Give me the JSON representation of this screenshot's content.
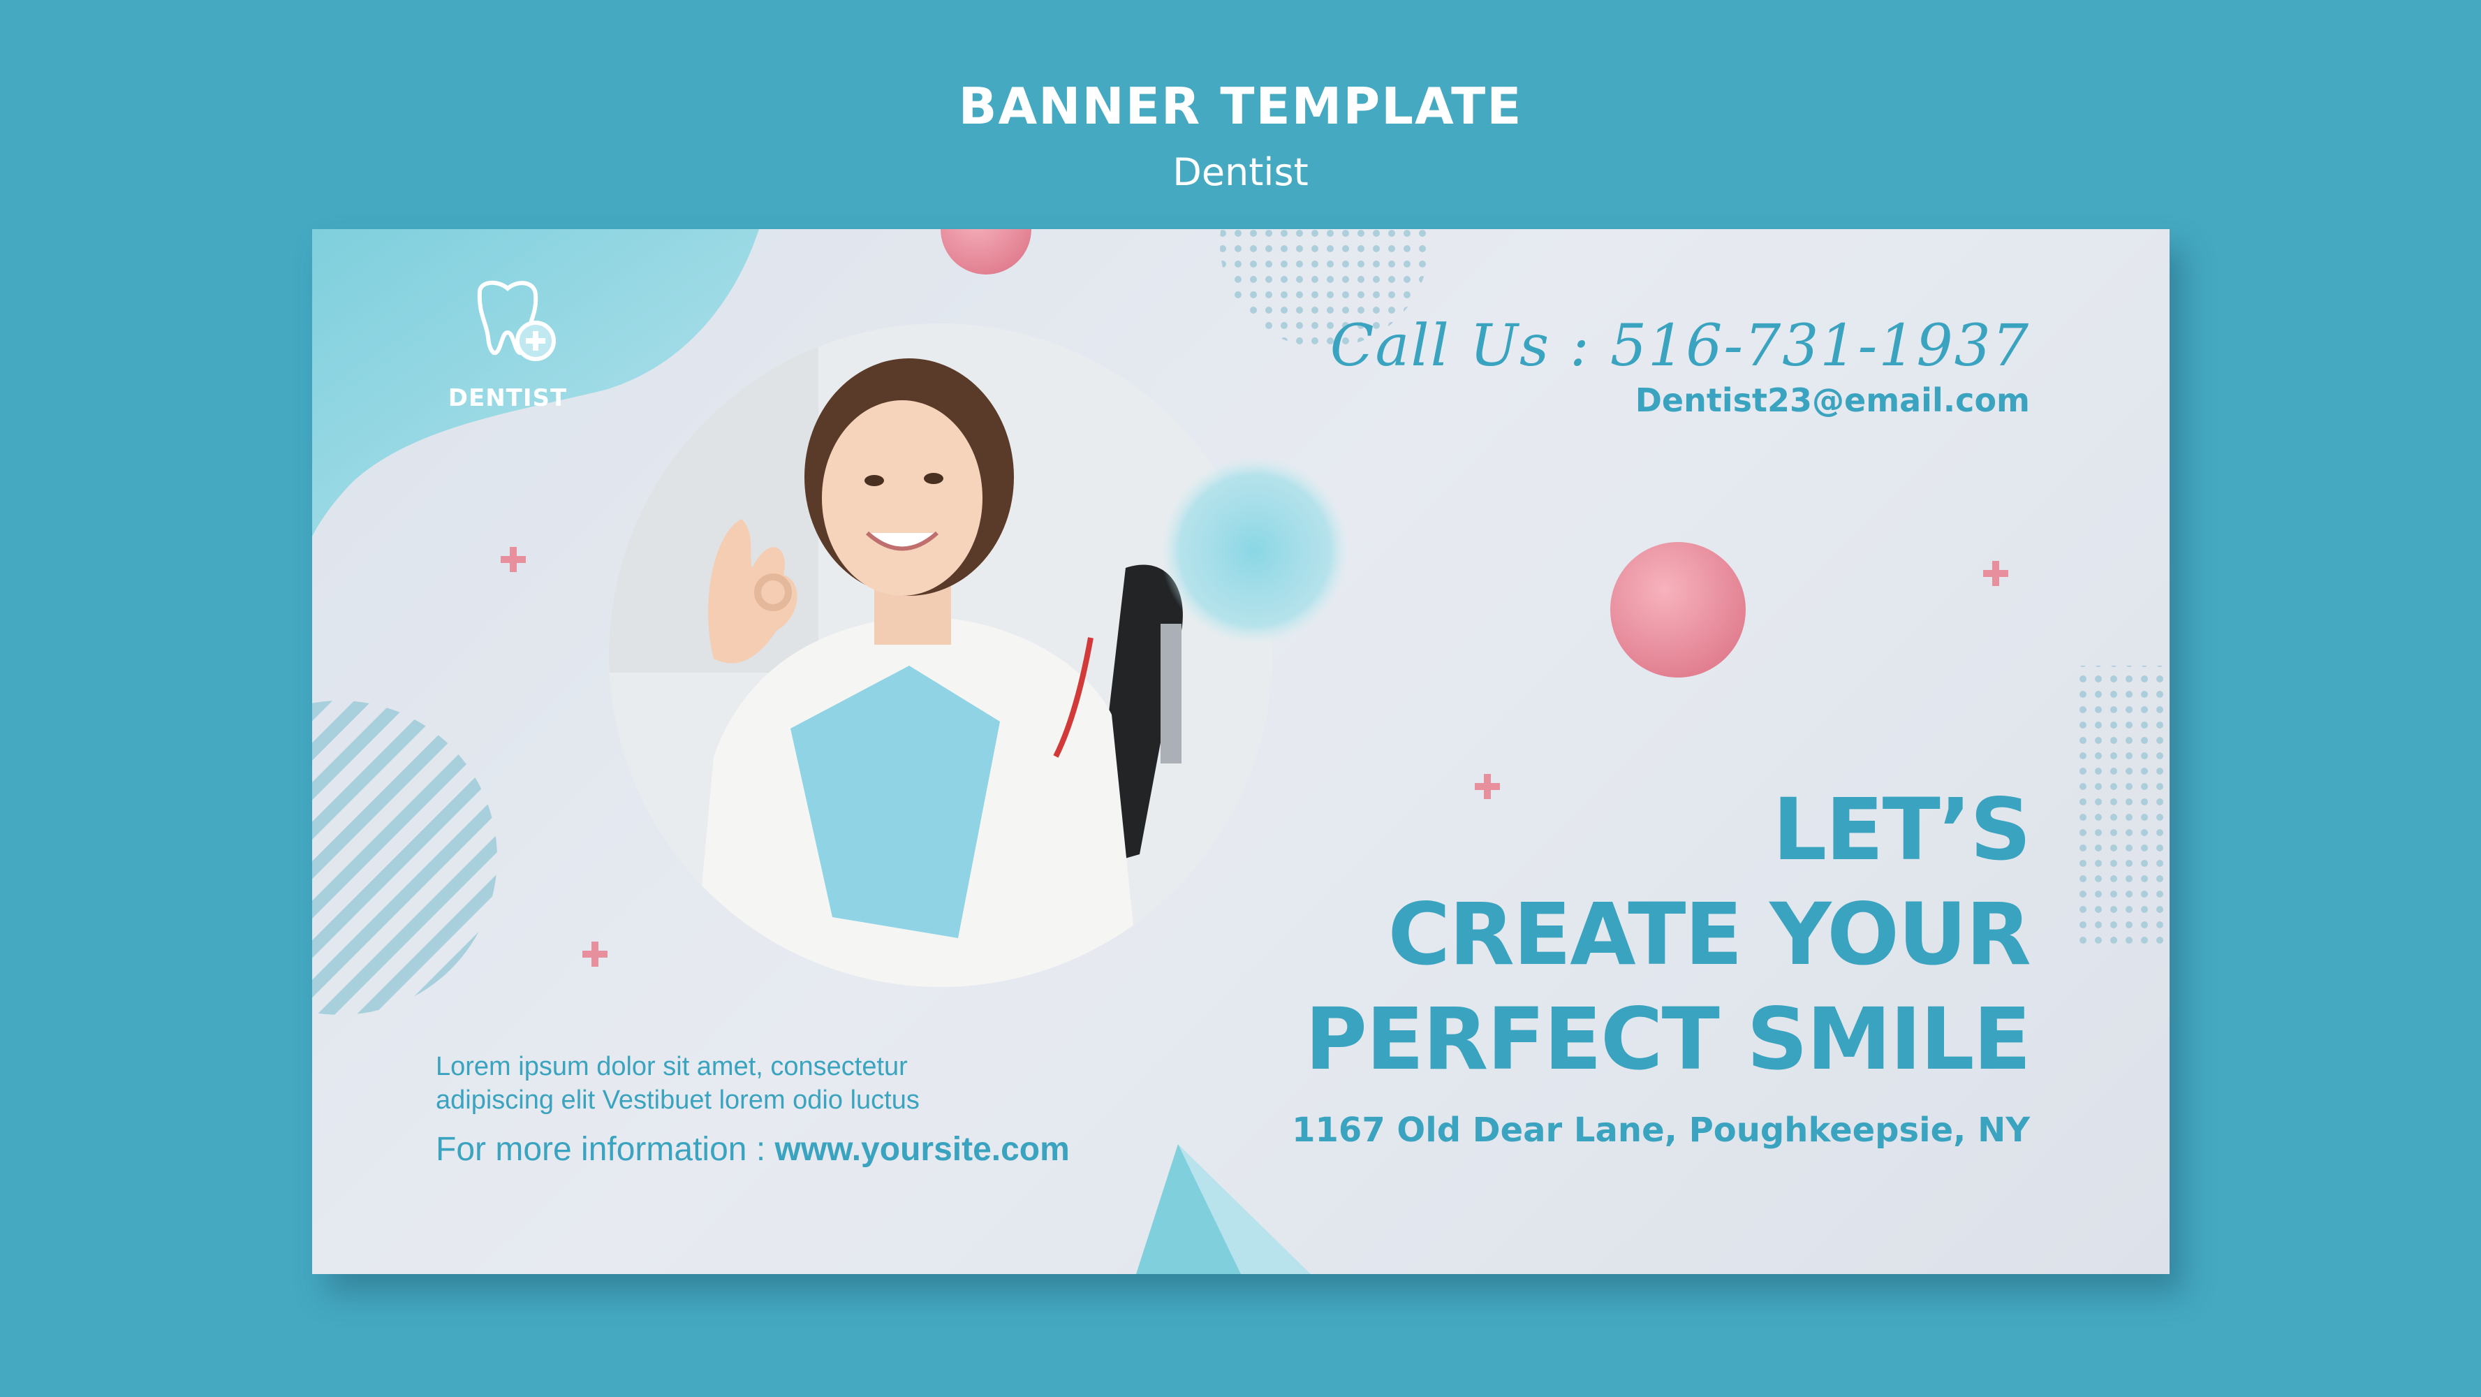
{
  "header": {
    "title": "BANNER TEMPLATE",
    "subtitle": "Dentist"
  },
  "banner": {
    "logo_text": "DENTIST",
    "call_text": "Call Us : 516-731-1937",
    "email": "Dentist23@email.com",
    "headline": [
      "LET’S",
      "CREATE YOUR",
      "PERFECT SMILE"
    ],
    "address": "1167  Old Dear Lane, Poughkeepsie, NY",
    "lorem_lines": [
      "Lorem ipsum dolor sit amet, consectetur",
      "adipiscing elit Vestibuet lorem odio luctus"
    ],
    "more_info_label": "For more information : ",
    "website": "www.yoursite.com"
  },
  "colors": {
    "background": "#45a9c2",
    "accent": "#3aa3bf",
    "pink": "#e88f9e",
    "card": "#e2e7ee"
  }
}
